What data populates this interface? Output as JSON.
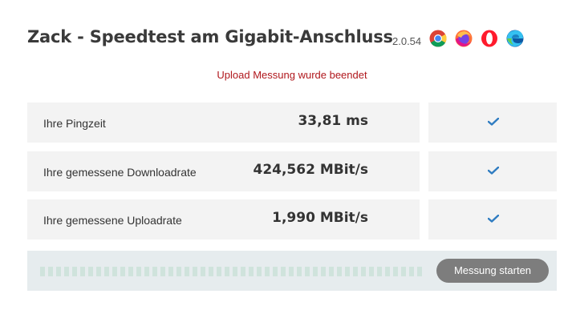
{
  "header": {
    "title": "Zack - Speedtest am Gigabit-Anschluss",
    "version": "2.0.54",
    "browser_icons": [
      "chrome-icon",
      "firefox-icon",
      "opera-icon",
      "edge-icon"
    ]
  },
  "status": {
    "text": "Upload Messung wurde beendet",
    "color": "#b0171c"
  },
  "results": [
    {
      "label": "Ihre Pingzeit",
      "value": "33,81 ms",
      "status_icon": "check-icon"
    },
    {
      "label": "Ihre gemessene Downloadrate",
      "value": "424,562 MBit/s",
      "status_icon": "check-icon"
    },
    {
      "label": "Ihre gemessene Uploadrate",
      "value": "1,990 MBit/s",
      "status_icon": "check-icon"
    }
  ],
  "progress": {
    "fraction": 0
  },
  "start_button": {
    "label": "Messung starten"
  },
  "colors": {
    "accent_check": "#2f7cc1",
    "panel": "#f3f3f3",
    "progress_bg": "#e6ecee",
    "button": "#7d7d7d"
  }
}
